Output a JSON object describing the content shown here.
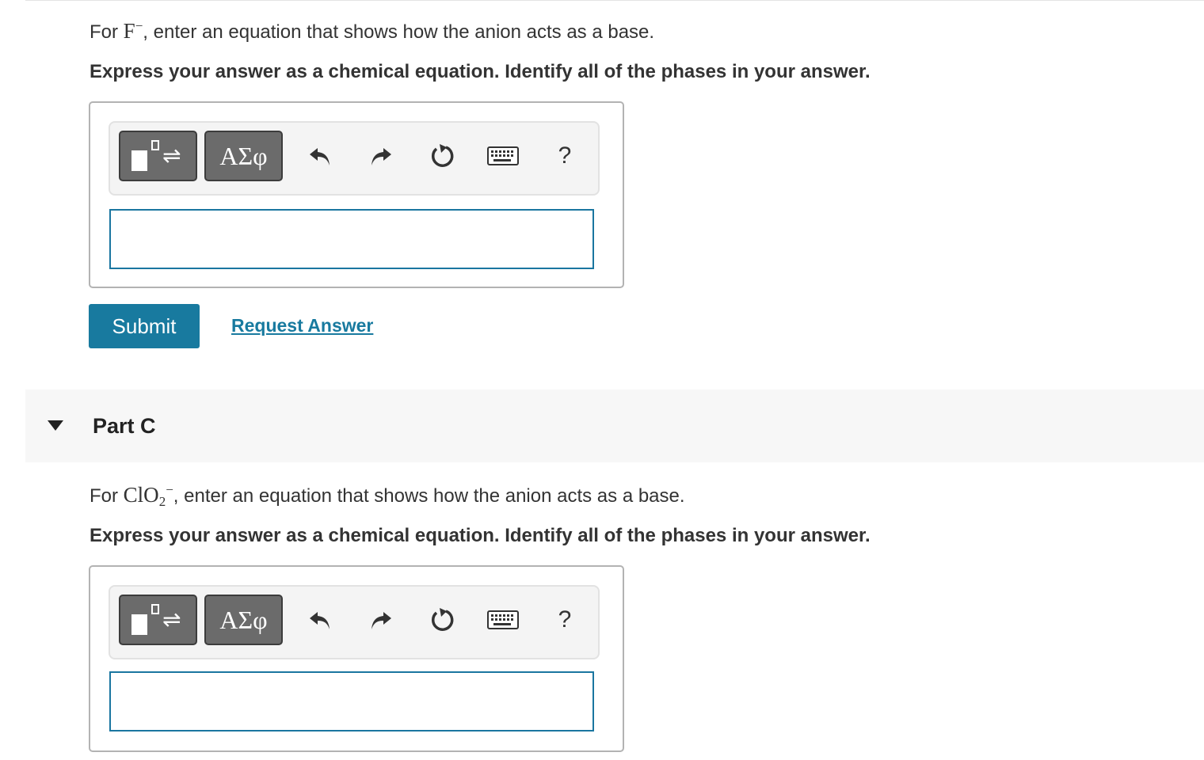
{
  "part_b": {
    "prompt_prefix": "For ",
    "formula": "F",
    "formula_sub": "",
    "formula_charge": "−",
    "prompt_suffix": ", enter an equation that shows how the anion acts as a base.",
    "instruction": "Express your answer as a chemical equation. Identify all of the phases in your answer.",
    "answer_value": "",
    "submit_label": "Submit",
    "request_answer_label": "Request Answer"
  },
  "part_c": {
    "title": "Part C",
    "prompt_prefix": "For ",
    "formula": "ClO",
    "formula_sub": "2",
    "formula_charge": "−",
    "prompt_suffix": ", enter an equation that shows how the anion acts as a base.",
    "instruction": "Express your answer as a chemical equation. Identify all of the phases in your answer.",
    "answer_value": ""
  },
  "toolbar": {
    "symbols_label": "ΑΣφ",
    "help_label": "?",
    "icons": [
      "templates-icon",
      "symbols-icon",
      "undo-icon",
      "redo-icon",
      "reset-icon",
      "keyboard-icon",
      "help-icon"
    ]
  },
  "colors": {
    "accent": "#187a9f",
    "toolbar_button": "#6b6b6b",
    "part_header_bg": "#f7f7f7",
    "input_border": "#1a76a0"
  }
}
